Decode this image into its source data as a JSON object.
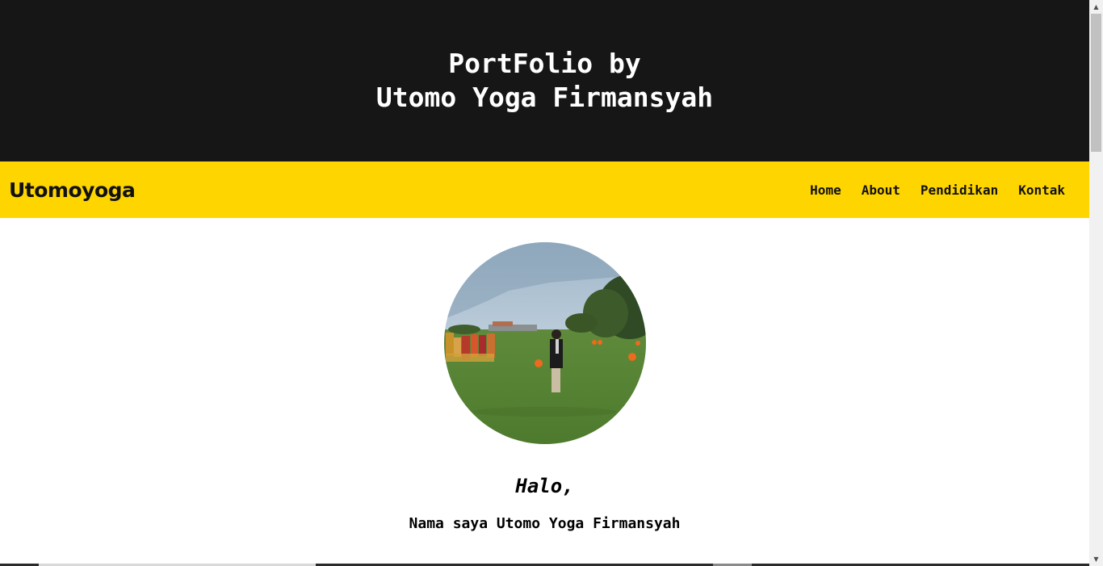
{
  "hero": {
    "line1": "PortFolio by",
    "line2": "Utomo Yoga Firmansyah"
  },
  "navbar": {
    "brand": "Utomoyoga",
    "links": [
      {
        "label": "Home"
      },
      {
        "label": "About"
      },
      {
        "label": "Pendidikan"
      },
      {
        "label": "Kontak"
      }
    ]
  },
  "profile": {
    "greeting": "Halo,",
    "intro": "Nama saya Utomo Yoga Firmansyah"
  },
  "scrollbar": {
    "up_icon": "triangle-up-icon",
    "down_icon": "triangle-down-icon",
    "up_glyph": "▲",
    "down_glyph": "▼"
  },
  "colors": {
    "hero_bg": "#161616",
    "navbar_bg": "#ffd500",
    "text_dark": "#111111",
    "text_light": "#ffffff"
  }
}
